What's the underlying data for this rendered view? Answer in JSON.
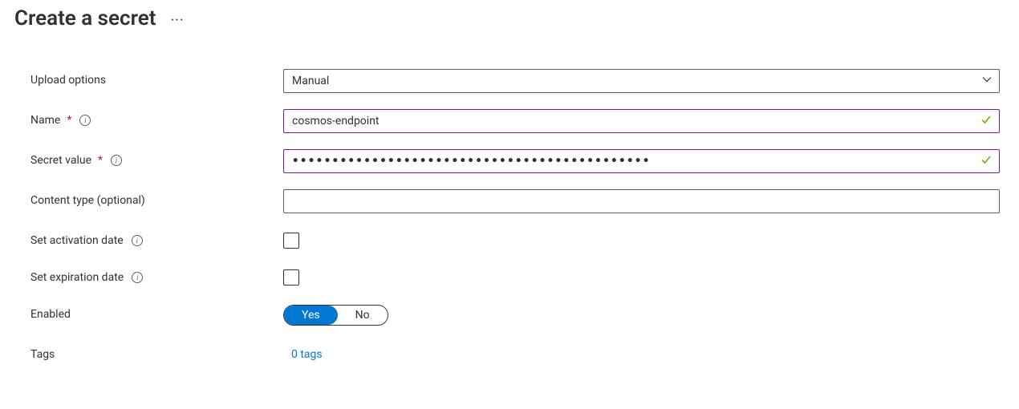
{
  "header": {
    "title": "Create a secret"
  },
  "form": {
    "upload_options": {
      "label": "Upload options",
      "value": "Manual"
    },
    "name": {
      "label": "Name",
      "value": "cosmos-endpoint",
      "valid": true
    },
    "secret_value": {
      "label": "Secret value",
      "masked": "•••••••••••••••••••••••••••••••••••••••••••••",
      "valid": true
    },
    "content_type": {
      "label": "Content type (optional)",
      "value": ""
    },
    "activation": {
      "label": "Set activation date",
      "checked": false
    },
    "expiration": {
      "label": "Set expiration date",
      "checked": false
    },
    "enabled": {
      "label": "Enabled",
      "yes": "Yes",
      "no": "No",
      "value": "Yes"
    },
    "tags": {
      "label": "Tags",
      "link": "0 tags"
    }
  }
}
